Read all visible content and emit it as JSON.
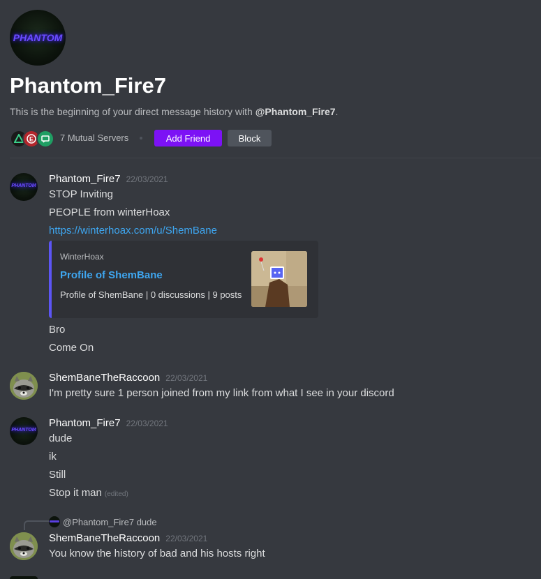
{
  "header": {
    "avatar_text": "PHANTOM",
    "username": "Phantom_Fire7",
    "intro_prefix": "This is the beginning of your direct message history with ",
    "intro_mention": "@Phantom_Fire7",
    "intro_suffix": ".",
    "mutual_servers": "7 Mutual Servers",
    "add_friend_label": "Add Friend",
    "block_label": "Block",
    "server_icons": [
      {
        "name": "triangle-server-icon",
        "color": "#1a1a1a",
        "accent": "#3ad08a"
      },
      {
        "name": "e-server-icon",
        "color": "#b3262c",
        "accent": "#ffffff"
      },
      {
        "name": "chat-server-icon",
        "color": "#1f9e63",
        "accent": "#ffffff"
      }
    ]
  },
  "messages": [
    {
      "author": "Phantom_Fire7",
      "timestamp": "22/03/2021",
      "lines": [
        "STOP Inviting",
        "PEOPLE from winterHoax"
      ],
      "link": "https://winterhoax.com/u/ShemBane",
      "embed": {
        "provider": "WinterHoax",
        "title": "Profile of ShemBane",
        "description": "Profile of ShemBane | 0 discussions | 9 posts"
      },
      "after_lines": [
        "Bro",
        "Come On"
      ]
    },
    {
      "author": "ShemBaneTheRaccoon",
      "timestamp": "22/03/2021",
      "lines": [
        "I'm pretty sure 1 person joined from my link from what I see in your discord"
      ]
    },
    {
      "author": "Phantom_Fire7",
      "timestamp": "22/03/2021",
      "lines": [
        "dude",
        "ik",
        "Still",
        "Stop it man"
      ],
      "edited_label": "(edited)"
    },
    {
      "reply_preview": "@Phantom_Fire7 dude",
      "author": "ShemBaneTheRaccoon",
      "timestamp": "22/03/2021",
      "lines": [
        "You know the history of bad and his hosts right"
      ]
    }
  ],
  "colors": {
    "background": "#36393f",
    "add_friend": "#7c12f5",
    "link": "#3ea6f0",
    "embed_border": "#5c55f5"
  }
}
